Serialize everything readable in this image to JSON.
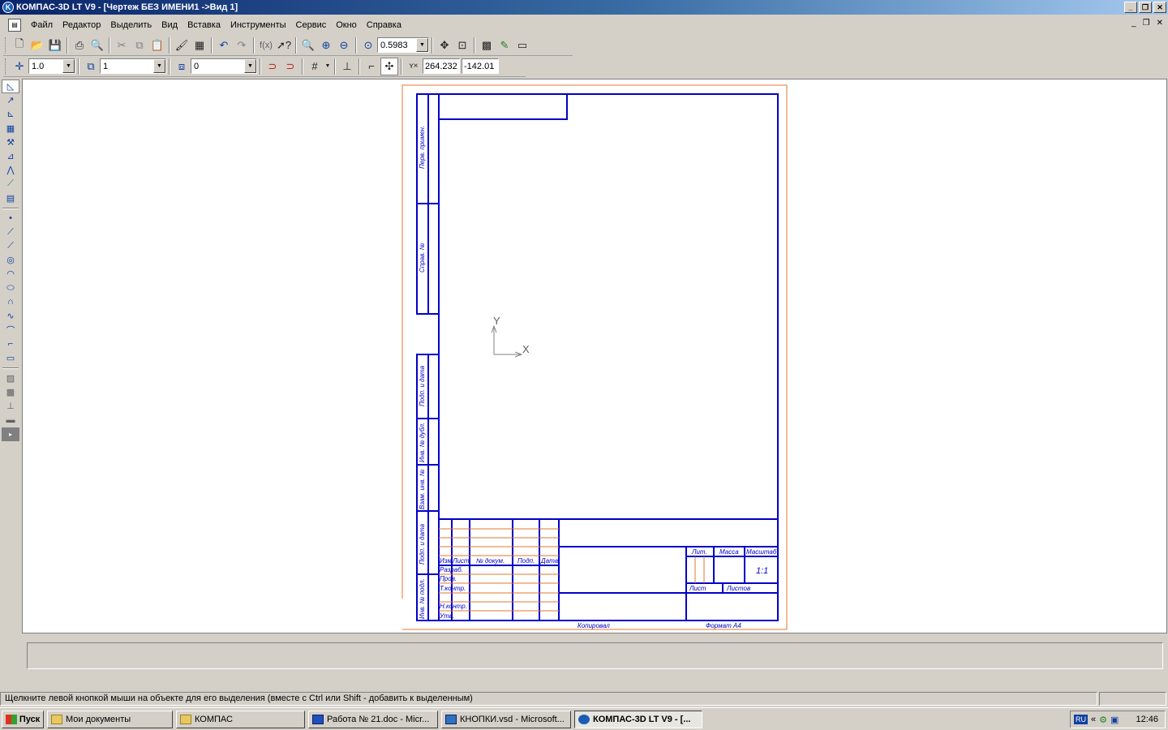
{
  "window": {
    "title": "КОМПАС-3D LT V9 - [Чертеж БЕЗ ИМЕНИ1 ->Вид 1]",
    "controls": [
      "_",
      "❐",
      "✕"
    ]
  },
  "menu": {
    "items": [
      "Файл",
      "Редактор",
      "Выделить",
      "Вид",
      "Вставка",
      "Инструменты",
      "Сервис",
      "Окно",
      "Справка"
    ],
    "doc_controls": [
      "_",
      "❐",
      "✕"
    ]
  },
  "toolbar_top": {
    "zoom_value": "0.5983"
  },
  "toolbar_current": {
    "step_value": "1.0",
    "view_value": "1",
    "layer_value": "0",
    "coord_x": "264.232",
    "coord_y": "-142.01"
  },
  "drawing": {
    "axis_x": "X",
    "axis_y": "Y",
    "side_labels": [
      "Перв. примен.",
      "Справ. №",
      "Подп. и дата",
      "Инв. № дубл.",
      "Взам. инв. №",
      "Подп. и дата",
      "Инв. № подл."
    ],
    "stamp": {
      "col_headers": [
        "Изм",
        "Лист",
        "№ докум.",
        "Подп.",
        "Дата"
      ],
      "row_labels": [
        "Разраб.",
        "Пров.",
        "Т.контр.",
        "Н.контр.",
        "Утв."
      ],
      "lit": "Лит.",
      "mass": "Масса",
      "scale": "Масштаб",
      "scale_value": "1:1",
      "sheet": "Лист",
      "sheets": "Листов"
    },
    "copied": "Копировал",
    "format": "Формат   А4"
  },
  "status": {
    "text": "Щелкните левой кнопкой мыши на объекте для его выделения (вместе с Ctrl или Shift - добавить к выделенным)"
  },
  "taskbar": {
    "start": "Пуск",
    "tasks": [
      "Мои документы",
      "КОМПАС",
      "Работа № 21.doc - Micr...",
      "КНОПКИ.vsd - Microsoft...",
      "КОМПАС-3D LT V9 - [..."
    ],
    "lang": "RU",
    "clock": "12:46"
  },
  "colors": {
    "frame": "#0000c8",
    "sheet_border": "#e07830",
    "stamp_lines": "#e07830"
  }
}
